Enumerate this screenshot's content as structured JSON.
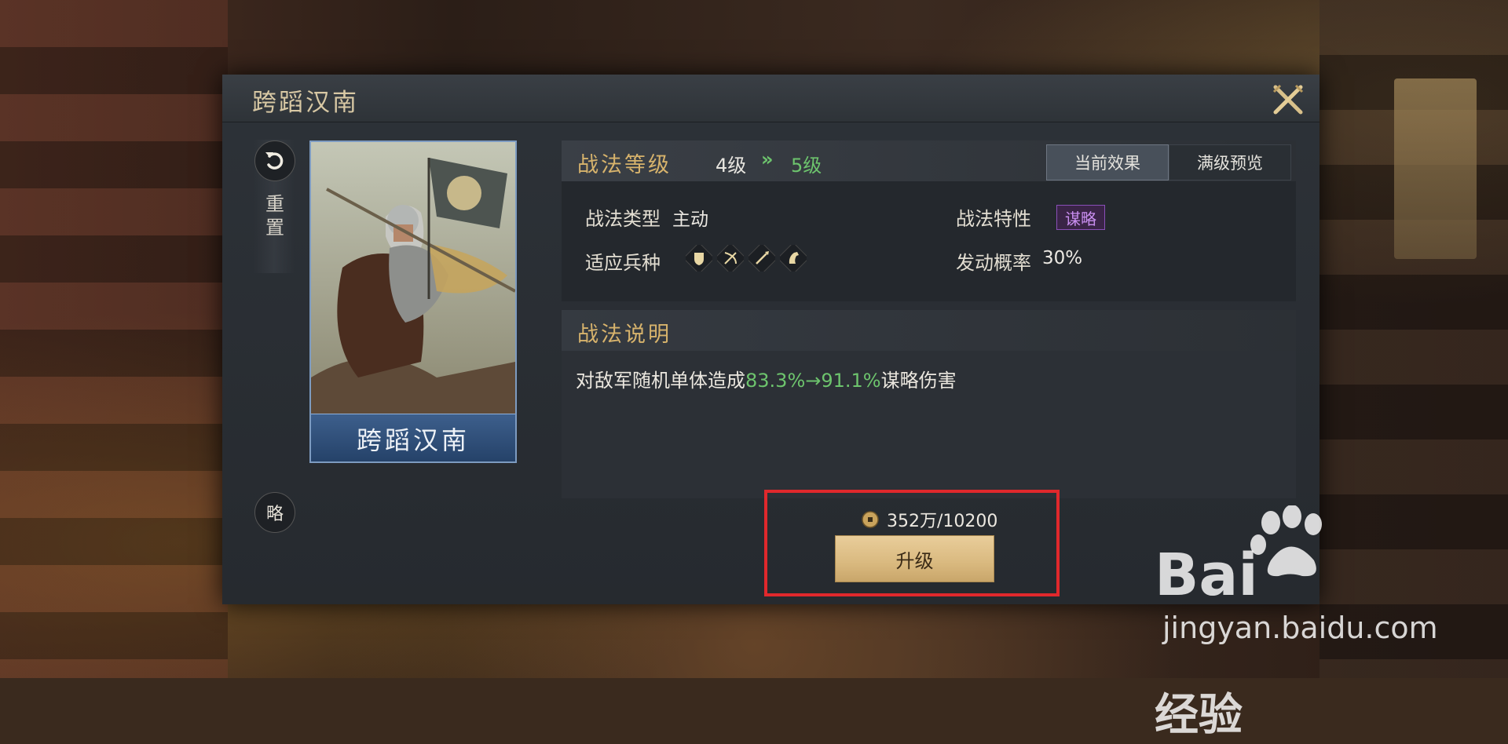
{
  "dialog": {
    "title": "跨蹈汉南",
    "close_icon": "crossed-swords-close-icon"
  },
  "sidebar": {
    "reset_label": "重置",
    "reset_icon": "rotate-ccw-icon",
    "type_badge": "略"
  },
  "card": {
    "name": "跨蹈汉南"
  },
  "level": {
    "label": "战法等级",
    "current": "4级",
    "arrow": "»",
    "next": "5级"
  },
  "tabs": [
    {
      "label": "当前效果",
      "active": true
    },
    {
      "label": "满级预览",
      "active": false
    }
  ],
  "stats": {
    "type_label": "战法类型",
    "type_value": "主动",
    "trait_label": "战法特性",
    "trait_value": "谋略",
    "troops_label": "适应兵种",
    "troop_icons": [
      "shield-icon",
      "bow-icon",
      "spear-icon",
      "horse-icon"
    ],
    "rate_label": "发动概率",
    "rate_value": "30%"
  },
  "description": {
    "title": "战法说明",
    "prefix": "对敌军随机单体造成",
    "values": "83.3%→91.1%",
    "suffix": "谋略伤害"
  },
  "upgrade": {
    "cost": "352万/10200",
    "button_label": "升级"
  },
  "watermark": {
    "brand": "Bai",
    "brand_suffix": "经验",
    "url": "jingyan.baidu.com"
  },
  "colors": {
    "accent_gold": "#d7b36c",
    "level_green": "#6dc46d",
    "highlight_red": "#e0282c",
    "tag_purple": "#8a4fb8"
  }
}
